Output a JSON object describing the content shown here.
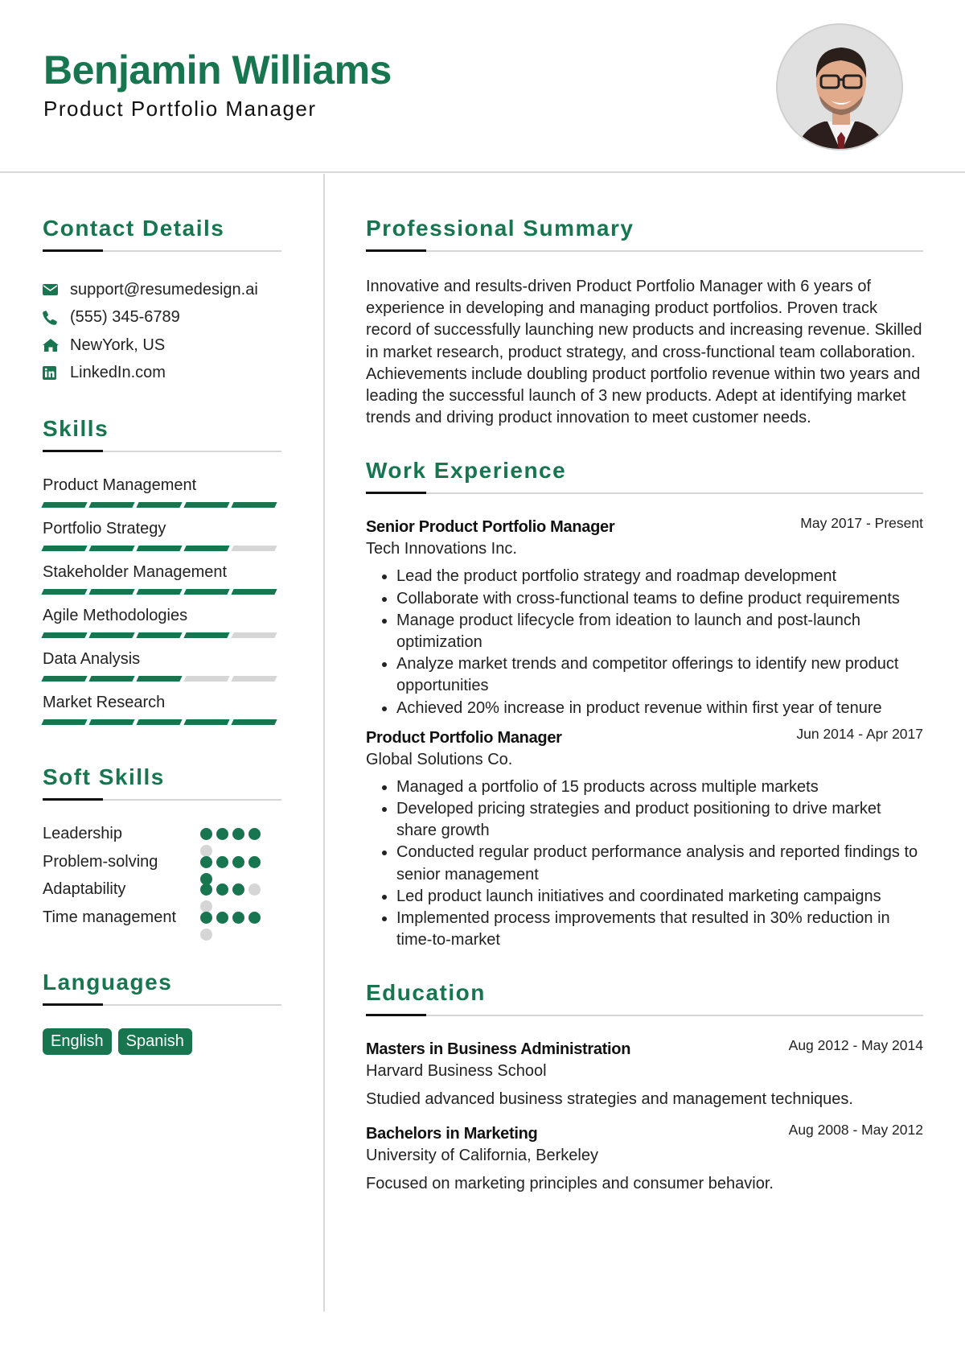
{
  "header": {
    "name": "Benjamin Williams",
    "title": "Product Portfolio Manager",
    "photo_alt": "Profile photo of Benjamin Williams"
  },
  "contact": {
    "heading": "Contact Details",
    "items": [
      {
        "icon": "envelope-icon",
        "text": "support@resumedesign.ai"
      },
      {
        "icon": "phone-icon",
        "text": "(555) 345-6789"
      },
      {
        "icon": "home-icon",
        "text": "NewYork, US"
      },
      {
        "icon": "linkedin-icon",
        "text": "LinkedIn.com"
      }
    ]
  },
  "skills": {
    "heading": "Skills",
    "max_level": 5,
    "items": [
      {
        "name": "Product Management",
        "level": 5
      },
      {
        "name": "Portfolio Strategy",
        "level": 4
      },
      {
        "name": "Stakeholder Management",
        "level": 5
      },
      {
        "name": "Agile Methodologies",
        "level": 4
      },
      {
        "name": "Data Analysis",
        "level": 3
      },
      {
        "name": "Market Research",
        "level": 5
      }
    ]
  },
  "soft_skills": {
    "heading": "Soft Skills",
    "max_level": 5,
    "items": [
      {
        "name": "Leadership",
        "level": 4
      },
      {
        "name": "Problem-solving",
        "level": 5
      },
      {
        "name": "Adaptability",
        "level": 3
      },
      {
        "name": "Time management",
        "level": 4
      }
    ]
  },
  "languages": {
    "heading": "Languages",
    "items": [
      "English",
      "Spanish"
    ]
  },
  "summary": {
    "heading": "Professional Summary",
    "text": "Innovative and results-driven Product Portfolio Manager with 6 years of experience in developing and managing product portfolios. Proven track record of successfully launching new products and increasing revenue. Skilled in market research, product strategy, and cross-functional team collaboration. Achievements include doubling product portfolio revenue within two years and leading the successful launch of 3 new products. Adept at identifying market trends and driving product innovation to meet customer needs."
  },
  "work": {
    "heading": "Work Experience",
    "jobs": [
      {
        "title": "Senior Product Portfolio Manager",
        "company": "Tech Innovations Inc.",
        "dates": "May 2017 - Present",
        "bullets": [
          "Lead the product portfolio strategy and roadmap development",
          "Collaborate with cross-functional teams to define product requirements",
          "Manage product lifecycle from ideation to launch and post-launch optimization",
          "Analyze market trends and competitor offerings to identify new product opportunities",
          "Achieved 20% increase in product revenue within first year of tenure"
        ]
      },
      {
        "title": "Product Portfolio Manager",
        "company": "Global Solutions Co.",
        "dates": "Jun 2014 - Apr 2017",
        "bullets": [
          "Managed a portfolio of 15 products across multiple markets",
          "Developed pricing strategies and product positioning to drive market share growth",
          "Conducted regular product performance analysis and reported findings to senior management",
          "Led product launch initiatives and coordinated marketing campaigns",
          "Implemented process improvements that resulted in 30% reduction in time-to-market"
        ]
      }
    ]
  },
  "education": {
    "heading": "Education",
    "items": [
      {
        "degree": "Masters in Business Administration",
        "school": "Harvard Business School",
        "dates": "Aug 2012 - May 2014",
        "description": "Studied advanced business strategies and management techniques."
      },
      {
        "degree": "Bachelors in Marketing",
        "school": "University of California, Berkeley",
        "dates": "Aug 2008 - May 2012",
        "description": "Focused on marketing principles and consumer behavior."
      }
    ]
  },
  "colors": {
    "accent": "#17754f",
    "rule_dark": "#111111",
    "rule_light": "#d6d6d6",
    "inactive": "#d6d6d6"
  }
}
